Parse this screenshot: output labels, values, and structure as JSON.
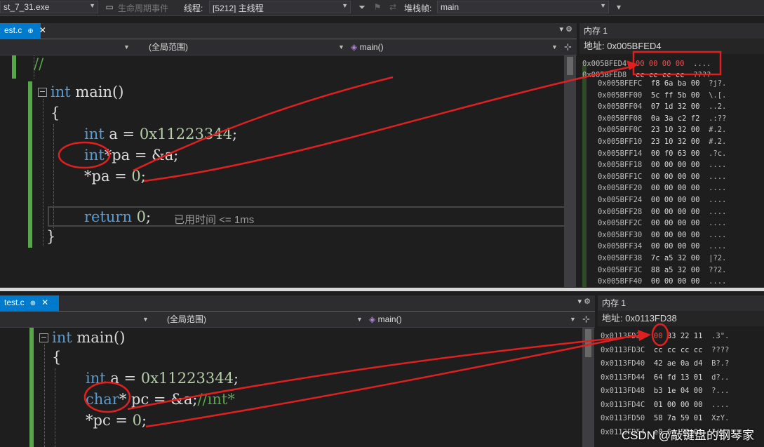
{
  "toolbar": {
    "process": "st_7_31.exe",
    "lifecycle": "生命周期事件",
    "thread_label": "线程:",
    "thread": "[5212] 主线程",
    "stackframe_label": "堆栈帧:",
    "stackframe": "main"
  },
  "top_editor": {
    "tab": "est.c",
    "scope": "(全局范围)",
    "function": "main()",
    "lines": {
      "comment": "//",
      "main_sig_kw": "int",
      "main_sig_rest": " main()",
      "open_brace": "{",
      "l1_kw": "int",
      "l1_rest": " a = ",
      "l1_num": "0x11223344",
      "l1_end": ";",
      "l2_kw": "int",
      "l2_rest": "*pa = &a;",
      "l3_rest": "*pa = ",
      "l3_num": "0",
      "l3_end": ";",
      "l4_kw": "return",
      "l4_num": " 0",
      "l4_end": ";",
      "close_brace": "}"
    },
    "elapsed": "已用时间 <= 1ms"
  },
  "top_memory": {
    "title": "内存 1",
    "addr_label": "地址:",
    "addr_value": "0x005BFED4",
    "rows": [
      {
        "addr": "0x005BFED4",
        "bytes": "00 00 00 00",
        "ascii": "....",
        "changed": true
      },
      {
        "addr": "0x005BFED8",
        "bytes": "cc cc cc cc",
        "ascii": "????"
      },
      {
        "addr": "0x005BFEFC",
        "bytes": "f8 6a ba 00",
        "ascii": "?j?."
      },
      {
        "addr": "0x005BFF00",
        "bytes": "5c ff 5b 00",
        "ascii": "\\.[."
      },
      {
        "addr": "0x005BFF04",
        "bytes": "07 1d 32 00",
        "ascii": "..2."
      },
      {
        "addr": "0x005BFF08",
        "bytes": "0a 3a c2 f2",
        "ascii": ".:??"
      },
      {
        "addr": "0x005BFF0C",
        "bytes": "23 10 32 00",
        "ascii": "#.2."
      },
      {
        "addr": "0x005BFF10",
        "bytes": "23 10 32 00",
        "ascii": "#.2."
      },
      {
        "addr": "0x005BFF14",
        "bytes": "00 f0 63 00",
        "ascii": ".?c."
      },
      {
        "addr": "0x005BFF18",
        "bytes": "00 00 00 00",
        "ascii": "...."
      },
      {
        "addr": "0x005BFF1C",
        "bytes": "00 00 00 00",
        "ascii": "...."
      },
      {
        "addr": "0x005BFF20",
        "bytes": "00 00 00 00",
        "ascii": "...."
      },
      {
        "addr": "0x005BFF24",
        "bytes": "00 00 00 00",
        "ascii": "...."
      },
      {
        "addr": "0x005BFF28",
        "bytes": "00 00 00 00",
        "ascii": "...."
      },
      {
        "addr": "0x005BFF2C",
        "bytes": "00 00 00 00",
        "ascii": "...."
      },
      {
        "addr": "0x005BFF30",
        "bytes": "00 00 00 00",
        "ascii": "...."
      },
      {
        "addr": "0x005BFF34",
        "bytes": "00 00 00 00",
        "ascii": "...."
      },
      {
        "addr": "0x005BFF38",
        "bytes": "7c a5 32 00",
        "ascii": "|?2."
      },
      {
        "addr": "0x005BFF3C",
        "bytes": "88 a5 32 00",
        "ascii": "??2."
      },
      {
        "addr": "0x005BFF40",
        "bytes": "00 00 00 00",
        "ascii": "...."
      }
    ]
  },
  "bottom_editor": {
    "tab": "test.c",
    "scope": "(全局范围)",
    "function": "main()",
    "lines": {
      "main_sig_kw": "int",
      "main_sig_rest": " main()",
      "open_brace": "{",
      "l1_kw": "int",
      "l1_rest": " a = ",
      "l1_num": "0x11223344",
      "l1_end": ";",
      "l2_kw": "char",
      "l2_rest": "* pc = &a;",
      "l2_cmt": "//int*",
      "l3_rest": "*pc = ",
      "l3_num": "0",
      "l3_end": ";"
    }
  },
  "bottom_memory": {
    "title": "内存 1",
    "addr_label": "地址:",
    "addr_value": "0x0113FD38",
    "rows": [
      {
        "addr": "0x0113FD38",
        "first": "00",
        "rest": " 33 22 11",
        "ascii": ".3\"."
      },
      {
        "addr": "0x0113FD3C",
        "first": "cc",
        "rest": " cc cc cc",
        "ascii": "????"
      },
      {
        "addr": "0x0113FD40",
        "first": "42",
        "rest": " ae 0a d4",
        "ascii": "B?.?"
      },
      {
        "addr": "0x0113FD44",
        "first": "64",
        "rest": " fd 13 01",
        "ascii": "d?.."
      },
      {
        "addr": "0x0113FD48",
        "first": "b3",
        "rest": " 1e 04 00",
        "ascii": "?..."
      },
      {
        "addr": "0x0113FD4C",
        "first": "01",
        "rest": " 00 00 00",
        "ascii": "...."
      },
      {
        "addr": "0x0113FD50",
        "first": "58",
        "rest": " 7a 59 01",
        "ascii": "XzY."
      },
      {
        "addr": "0x0113FD54",
        "first": "e8",
        "rest": " 6a 59 01",
        "ascii": "?jY."
      }
    ]
  },
  "watermark": "CSDN @敲键盘的钢琴家"
}
